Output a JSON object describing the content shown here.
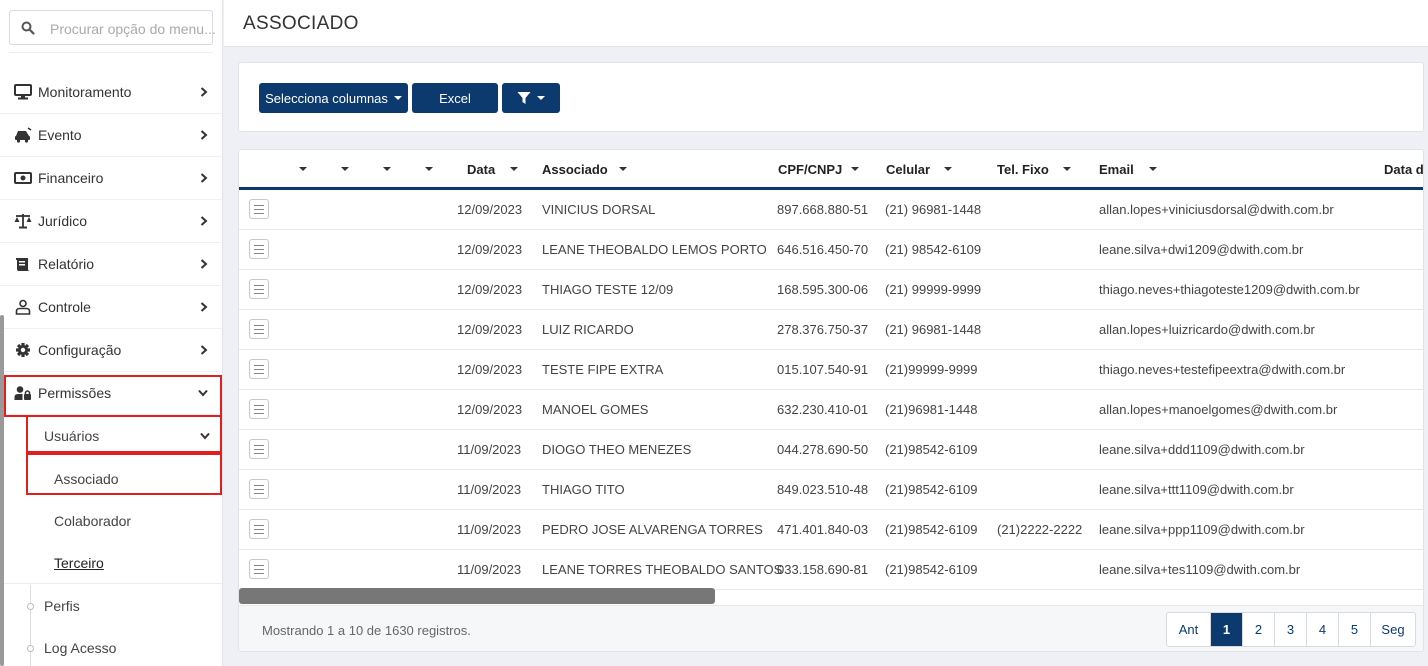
{
  "sidebar": {
    "search": {
      "placeholder": "Procurar opção do menu..."
    },
    "items": [
      {
        "label": "Monitoramento",
        "icon": "monitor-icon"
      },
      {
        "label": "Evento",
        "icon": "car-crash-icon"
      },
      {
        "label": "Financeiro",
        "icon": "money-bill-icon"
      },
      {
        "label": "Jurídico",
        "icon": "scale-icon"
      },
      {
        "label": "Relatório",
        "icon": "report-icon"
      },
      {
        "label": "Controle",
        "icon": "user-outline-icon"
      },
      {
        "label": "Configuração",
        "icon": "gear-icon"
      },
      {
        "label": "Permissões",
        "icon": "user-lock-icon"
      }
    ],
    "sub": {
      "label": "Usuários"
    },
    "sub_items": [
      {
        "label": "Associado"
      },
      {
        "label": "Colaborador"
      },
      {
        "label": "Terceiro"
      }
    ],
    "extra_items": [
      {
        "label": "Perfis"
      },
      {
        "label": "Log Acesso"
      }
    ]
  },
  "header": {
    "title": "ASSOCIADO"
  },
  "toolbar": {
    "select_columns": {
      "label": "Selecciona columnas"
    },
    "excel": {
      "label": "Excel"
    },
    "filter": {
      "icon": "filter-icon"
    }
  },
  "table": {
    "columns": [
      {
        "label": "Data"
      },
      {
        "label": "Associado"
      },
      {
        "label": "CPF/CNPJ"
      },
      {
        "label": "Celular"
      },
      {
        "label": "Tel. Fixo"
      },
      {
        "label": "Email"
      },
      {
        "label": "Data d"
      }
    ],
    "rows": [
      {
        "data": "12/09/2023",
        "associado": "VINICIUS DORSAL",
        "cpf": "897.668.880-51",
        "celular": "(21) 96981-1448",
        "fixo": "",
        "email": "allan.lopes+viniciusdorsal@dwith.com.br"
      },
      {
        "data": "12/09/2023",
        "associado": "LEANE THEOBALDO LEMOS PORTO",
        "cpf": "646.516.450-70",
        "celular": "(21) 98542-6109",
        "fixo": "",
        "email": "leane.silva+dwi1209@dwith.com.br"
      },
      {
        "data": "12/09/2023",
        "associado": "THIAGO TESTE 12/09",
        "cpf": "168.595.300-06",
        "celular": "(21) 99999-9999",
        "fixo": "",
        "email": "thiago.neves+thiagoteste1209@dwith.com.br"
      },
      {
        "data": "12/09/2023",
        "associado": "LUIZ RICARDO",
        "cpf": "278.376.750-37",
        "celular": "(21) 96981-1448",
        "fixo": "",
        "email": "allan.lopes+luizricardo@dwith.com.br"
      },
      {
        "data": "12/09/2023",
        "associado": "TESTE FIPE EXTRA",
        "cpf": "015.107.540-91",
        "celular": "(21)99999-9999",
        "fixo": "",
        "email": "thiago.neves+testefipeextra@dwith.com.br"
      },
      {
        "data": "12/09/2023",
        "associado": "MANOEL GOMES",
        "cpf": "632.230.410-01",
        "celular": "(21)96981-1448",
        "fixo": "",
        "email": "allan.lopes+manoelgomes@dwith.com.br"
      },
      {
        "data": "11/09/2023",
        "associado": "DIOGO THEO MENEZES",
        "cpf": "044.278.690-50",
        "celular": "(21)98542-6109",
        "fixo": "",
        "email": "leane.silva+ddd1109@dwith.com.br"
      },
      {
        "data": "11/09/2023",
        "associado": "THIAGO TITO",
        "cpf": "849.023.510-48",
        "celular": "(21)98542-6109",
        "fixo": "",
        "email": "leane.silva+ttt1109@dwith.com.br"
      },
      {
        "data": "11/09/2023",
        "associado": "PEDRO JOSE ALVARENGA TORRES",
        "cpf": "471.401.840-03",
        "celular": "(21)98542-6109",
        "fixo": "(21)2222-2222",
        "email": "leane.silva+ppp1109@dwith.com.br"
      },
      {
        "data": "11/09/2023",
        "associado": "LEANE TORRES THEOBALDO SANTOS",
        "cpf": "033.158.690-81",
        "celular": "(21)98542-6109",
        "fixo": "",
        "email": "leane.silva+tes1109@dwith.com.br"
      }
    ]
  },
  "footer": {
    "info": "Mostrando 1 a 10 de 1630 registros."
  },
  "pagination": {
    "prev": {
      "label": "Ant"
    },
    "pages": [
      {
        "label": "1"
      },
      {
        "label": "2"
      },
      {
        "label": "3"
      },
      {
        "label": "4"
      },
      {
        "label": "5"
      }
    ],
    "next": {
      "label": "Seg"
    },
    "active": "1"
  },
  "colors": {
    "primary": "#0d3a6e",
    "highlight": "#e02020"
  }
}
